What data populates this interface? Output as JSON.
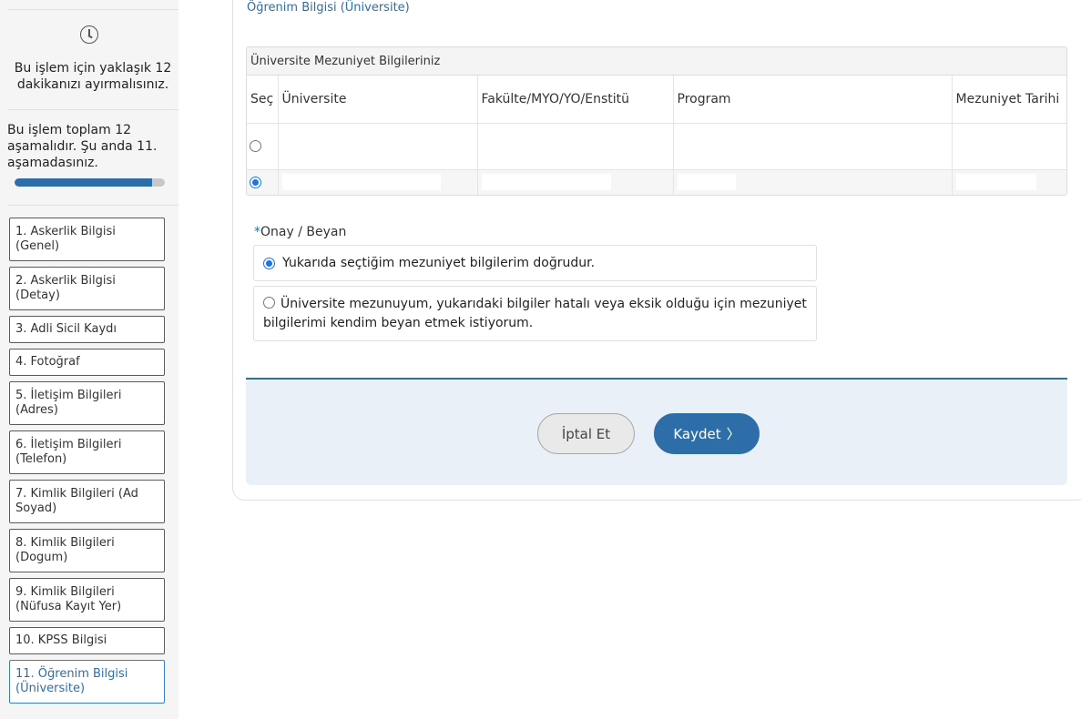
{
  "sidebar": {
    "time_note": "Bu işlem için yaklaşık 12 dakikanızı ayırmalısınız.",
    "stage_note": "Bu işlem toplam 12 aşamalıdır. Şu anda 11. aşamadasınız.",
    "progress_fraction": 0.917,
    "steps": [
      {
        "label": "1. Askerlik Bilgisi (Genel)"
      },
      {
        "label": "2. Askerlik Bilgisi (Detay)"
      },
      {
        "label": "3. Adli Sicil Kaydı"
      },
      {
        "label": "4. Fotoğraf"
      },
      {
        "label": "5. İletişim Bilgileri (Adres)"
      },
      {
        "label": "6. İletişim Bilgileri (Telefon)"
      },
      {
        "label": "7. Kimlik Bilgileri (Ad Soyad)"
      },
      {
        "label": "8. Kimlik Bilgileri (Dogum)"
      },
      {
        "label": "9. Kimlik Bilgileri (Nüfusa Kayıt Yer)"
      },
      {
        "label": "10. KPSS Bilgisi"
      },
      {
        "label": "11. Öğrenim Bilgisi (Üniversite)"
      }
    ]
  },
  "main": {
    "breadcrumb": "Öğrenim Bilgisi (Üniversite)",
    "table": {
      "caption": "Üniversite Mezuniyet Bilgileriniz",
      "headers": [
        "Seç",
        "Üniversite",
        "Fakülte/MYO/YO/Enstitü",
        "Program",
        "Mezuniyet Tarihi"
      ]
    },
    "consent": {
      "required_mark": "*",
      "label": "Onay / Beyan",
      "option1": "Yukarıda seçtiğim mezuniyet bilgilerim doğrudur.",
      "option2": "Üniversite mezunuyum, yukarıdaki bilgiler hatalı veya eksik olduğu için mezuniyet bilgilerimi kendim beyan etmek istiyorum."
    },
    "actions": {
      "cancel": "İptal Et",
      "save": "Kaydet",
      "save_chevron": "〉"
    }
  }
}
